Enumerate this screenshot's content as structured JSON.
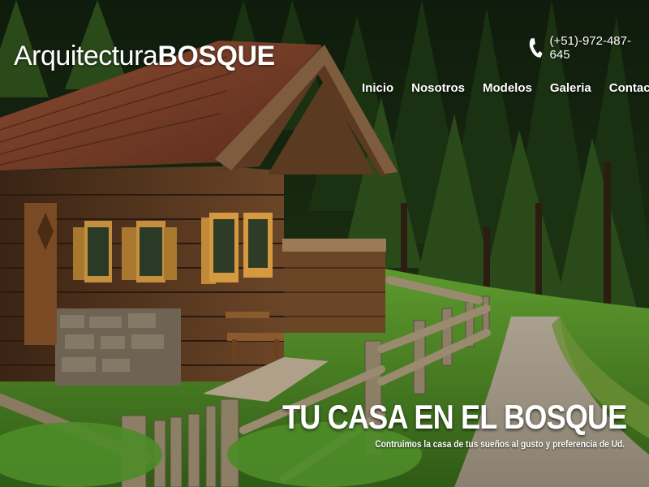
{
  "brand": {
    "logo_thin": "Arquitectura",
    "logo_bold": "BOSQUE"
  },
  "contact": {
    "phone_icon": "phone-icon",
    "phone": "(+51)-972-487-645"
  },
  "nav": {
    "items": [
      {
        "label": "Inicio"
      },
      {
        "label": "Nosotros"
      },
      {
        "label": "Modelos"
      },
      {
        "label": "Galeria"
      },
      {
        "label": "Contactos"
      }
    ]
  },
  "hero": {
    "title": "TU CASA EN EL BOSQUE",
    "subtitle": "Contruimos la casa de tus sueños al gusto y preferencia de Ud."
  },
  "colors": {
    "text": "#ffffff",
    "forest_dark": "#13200f",
    "grass": "#4f8a28",
    "roof": "#7a3d28",
    "wood": "#5a3a22"
  }
}
